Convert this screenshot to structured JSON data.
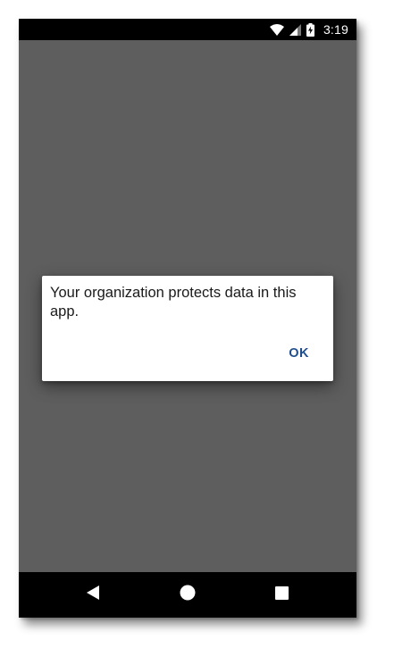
{
  "status_bar": {
    "time": "3:19",
    "icons": [
      "wifi-icon",
      "signal-icon",
      "battery-charging-icon"
    ]
  },
  "dialog": {
    "message": "Your organization protects data in this app.",
    "ok_label": "OK",
    "accent_color": "#1f4e8c"
  },
  "nav_bar": {
    "icons": [
      "back-icon",
      "home-icon",
      "recents-icon"
    ]
  },
  "colors": {
    "scrim": "#5e5e5e",
    "bars": "#000000",
    "dialog_bg": "#ffffff"
  }
}
